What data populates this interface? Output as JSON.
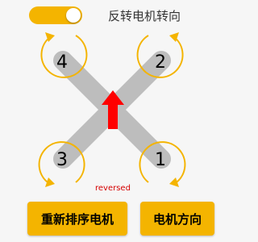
{
  "header": {
    "toggle_on": true,
    "toggle_label": "反转电机转向"
  },
  "motors": [
    {
      "label": "4"
    },
    {
      "label": "2"
    },
    {
      "label": "3"
    },
    {
      "label": "1"
    }
  ],
  "status_text": "reversed",
  "buttons": {
    "rearrange_label": "重新排序电机",
    "direction_label": "电机方向"
  },
  "colors": {
    "accent": "#f4b400",
    "arms": "#bdbdbd",
    "arrow": "#ff0000",
    "status": "#d50000"
  }
}
